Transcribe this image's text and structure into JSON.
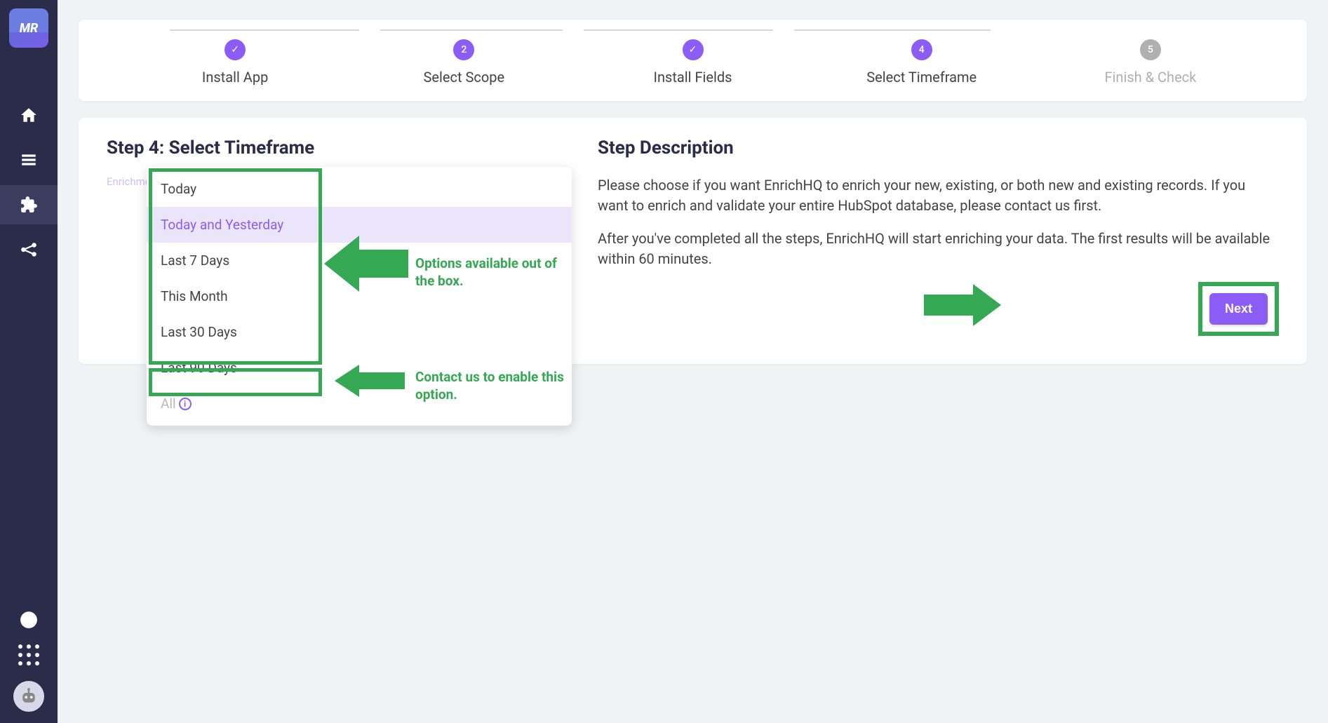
{
  "sidebar": {
    "logo_text": "MR"
  },
  "stepper": {
    "steps": [
      {
        "label": "Install App",
        "indicator": "✓",
        "active": true
      },
      {
        "label": "Select Scope",
        "indicator": "2",
        "active": true
      },
      {
        "label": "Install Fields",
        "indicator": "✓",
        "active": true
      },
      {
        "label": "Select Timeframe",
        "indicator": "4",
        "active": true
      },
      {
        "label": "Finish & Check",
        "indicator": "5",
        "active": false
      }
    ]
  },
  "content": {
    "step_title": "Step 4: Select Timeframe",
    "field_label": "Enrichment Timeframe",
    "desc_title": "Step Description",
    "desc_p1": "Please choose if you want EnrichHQ to enrich your new, existing, or both new and existing records. If you want to enrich and validate your entire HubSpot database, please contact us first.",
    "desc_p2": "After you've completed all the steps, EnrichHQ will start enriching your data. The first results will be available within 60 minutes.",
    "next_label": "Next"
  },
  "dropdown": {
    "options": [
      {
        "label": "Today",
        "selected": false,
        "disabled": false
      },
      {
        "label": "Today and Yesterday",
        "selected": true,
        "disabled": false
      },
      {
        "label": "Last 7 Days",
        "selected": false,
        "disabled": false
      },
      {
        "label": "This Month",
        "selected": false,
        "disabled": false
      },
      {
        "label": "Last 30 Days",
        "selected": false,
        "disabled": false
      },
      {
        "label": "Last 90 Days",
        "selected": false,
        "disabled": false
      },
      {
        "label": "All",
        "selected": false,
        "disabled": true
      }
    ]
  },
  "annotations": {
    "a1": "Options available out of the box.",
    "a2": "Contact us to enable this option."
  }
}
